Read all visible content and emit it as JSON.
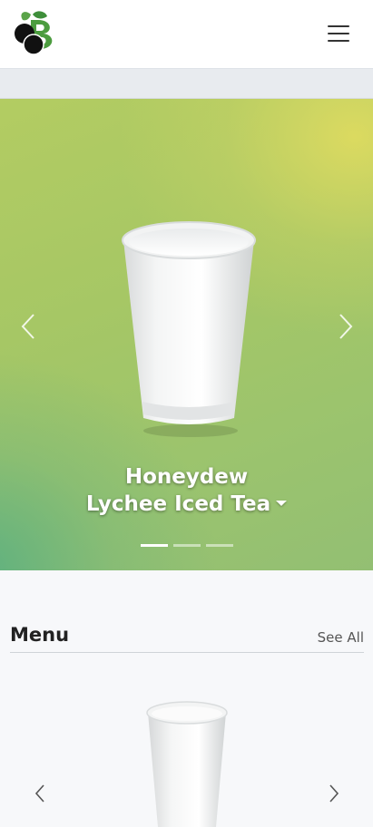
{
  "navbar": {
    "logo_icon": "boba-blueberry-logo-icon",
    "menu_icon": "hamburger-menu-icon"
  },
  "carousel": {
    "caption_line1": "Honeydew",
    "caption_line2": "Lychee Iced Tea",
    "slide_count": 3,
    "active_slide": 1,
    "prev_icon": "chevron-left-icon",
    "next_icon": "chevron-right-icon",
    "background_colors": [
      "#dcd95c",
      "#a6c765",
      "#5fb07f"
    ]
  },
  "menu": {
    "title": "Menu",
    "see_all": "See All",
    "prev_icon": "chevron-left-icon",
    "next_icon": "chevron-right-icon"
  }
}
